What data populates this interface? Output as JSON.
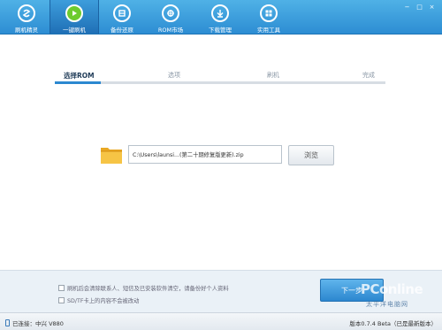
{
  "toolbar": {
    "items": [
      {
        "label": "刷机精灵",
        "icon": "brush-logo-icon"
      },
      {
        "label": "一键刷机",
        "icon": "play-icon"
      },
      {
        "label": "备份还原",
        "icon": "backup-icon"
      },
      {
        "label": "ROM市场",
        "icon": "rom-market-icon"
      },
      {
        "label": "下载管理",
        "icon": "download-icon"
      },
      {
        "label": "实用工具",
        "icon": "tools-icon"
      }
    ],
    "active_index": 1,
    "colors": {
      "bar": "#2d8dd3",
      "active_icon": "#6dcb2e"
    }
  },
  "window_controls": {
    "minimize": "−",
    "maximize": "□",
    "close": "×"
  },
  "steps": {
    "items": [
      "选择ROM",
      "选项",
      "刷机",
      "完成"
    ],
    "current": 0,
    "progress": 0.14
  },
  "file_select": {
    "path_value": "C:\\Users\\launsi...(第二十期修复版更新).zip",
    "browse_label": "浏览"
  },
  "notes": [
    "刷机后会清除联系人、短信及已安装软件清空，请备份好个人资料",
    "SD/TF卡上的内容不会被改动"
  ],
  "next_label": "下一步",
  "status": {
    "connection": "已连接：中兴 V880",
    "version": "版本0.7.4 Beta（已是最新版本）"
  },
  "watermark": {
    "brand": "PConline",
    "sub": "太平洋电脑网"
  }
}
